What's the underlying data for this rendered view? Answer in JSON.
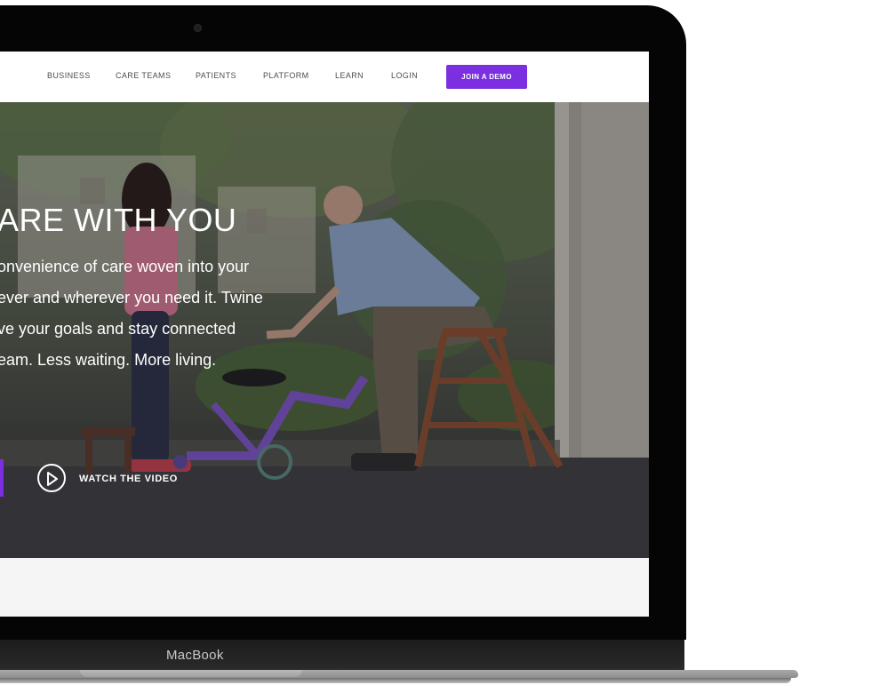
{
  "nav": {
    "items": [
      "BUSINESS",
      "CARE TEAMS",
      "PATIENTS",
      "PLATFORM",
      "LEARN",
      "LOGIN"
    ],
    "cta_label": "JOIN A DEMO",
    "cta_color": "#7b2fe0"
  },
  "hero": {
    "title": "ARE WITH YOU",
    "lines": [
      "onvenience of care woven into your",
      "ever and wherever you need it. Twine",
      "ve your goals and stay connected",
      "eam. Less waiting. More living."
    ],
    "watch_label": "WATCH THE VIDEO",
    "play_icon": "play-circle-icon"
  },
  "device": {
    "brand": "MacBook"
  }
}
